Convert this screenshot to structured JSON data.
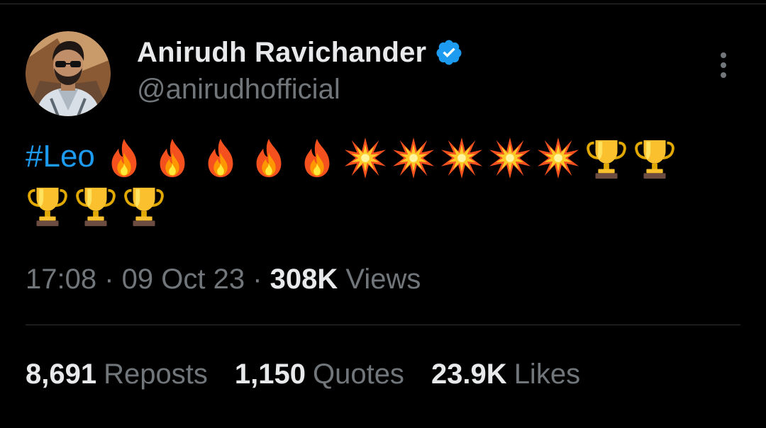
{
  "tweet": {
    "author": {
      "display_name": "Anirudh Ravichander",
      "handle": "@anirudhofficial",
      "verified": true
    },
    "text": {
      "hashtag": "#Leo",
      "emojis": [
        "fire",
        "fire",
        "fire",
        "fire",
        "fire",
        "collision",
        "collision",
        "collision",
        "collision",
        "collision",
        "trophy",
        "trophy",
        "trophy",
        "trophy",
        "trophy"
      ]
    },
    "meta": {
      "time": "17:08",
      "separator": " · ",
      "date": "09 Oct 23",
      "views_count": "308K",
      "views_label": "Views"
    },
    "stats": {
      "reposts_count": "8,691",
      "reposts_label": "Reposts",
      "quotes_count": "1,150",
      "quotes_label": "Quotes",
      "likes_count": "23.9K",
      "likes_label": "Likes"
    }
  },
  "icons": {
    "verified": "verified-badge-icon",
    "more": "more-options-icon"
  },
  "colors": {
    "background": "#000000",
    "primary_text": "#e7e9ea",
    "secondary_text": "#71767b",
    "link": "#1d9bf0",
    "verified": "#1d9bf0",
    "divider": "#2f3336"
  }
}
